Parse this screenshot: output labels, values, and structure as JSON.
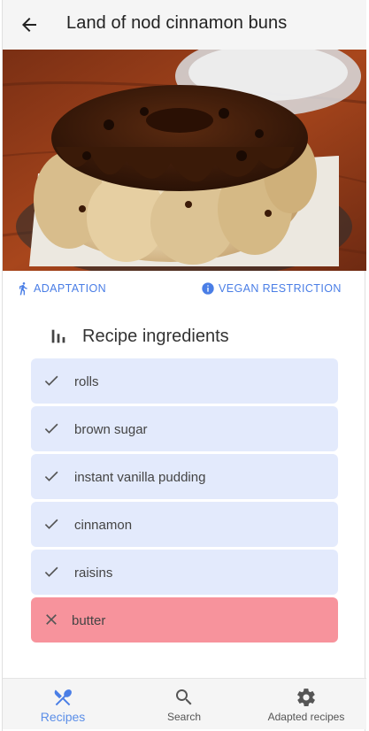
{
  "appbar": {
    "title": "Land of nod cinnamon buns",
    "back_icon": "arrow-back-icon"
  },
  "hero": {
    "image_subject": "cinnamon-buns-bundt-photo"
  },
  "chips": {
    "adaptation_label": "ADAPTATION",
    "adaptation_icon": "walking-person-icon",
    "vegan_label": "VEGAN RESTRICTION",
    "vegan_icon": "info-icon"
  },
  "ingredients": {
    "title": "Recipe ingredients",
    "icon": "bar-chart-icon",
    "items": [
      {
        "label": "rolls",
        "status": "ok",
        "icon": "check-icon"
      },
      {
        "label": "brown sugar",
        "status": "ok",
        "icon": "check-icon"
      },
      {
        "label": "instant vanilla pudding",
        "status": "ok",
        "icon": "check-icon"
      },
      {
        "label": "cinnamon",
        "status": "ok",
        "icon": "check-icon"
      },
      {
        "label": "raisins",
        "status": "ok",
        "icon": "check-icon"
      },
      {
        "label": "butter",
        "status": "restricted",
        "icon": "close-icon"
      }
    ]
  },
  "bottom_nav": {
    "items": [
      {
        "label": "Recipes",
        "icon": "utensils-icon",
        "active": true
      },
      {
        "label": "Search",
        "icon": "search-icon",
        "active": false
      },
      {
        "label": "Adapted recipes",
        "icon": "gear-icon",
        "active": false
      }
    ]
  },
  "colors": {
    "accent": "#4a7ee6",
    "nav_active": "#5b8ee8",
    "ok_row": "#e3eafc",
    "restricted_row": "#f7939c",
    "appbar_bg": "#f5f5f5"
  }
}
